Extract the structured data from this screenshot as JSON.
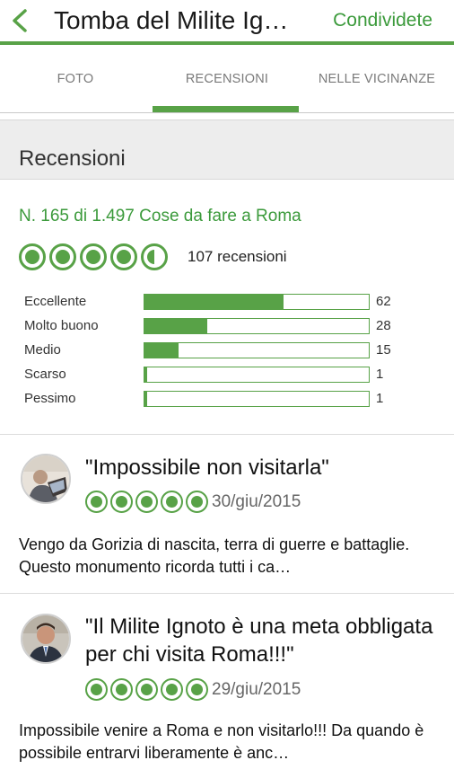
{
  "header": {
    "title": "Tomba del Milite Ig…",
    "share_label": "Condividete",
    "back_icon": "chevron-left-icon",
    "accent_color": "#58a247"
  },
  "tabs": [
    {
      "label": "FOTO",
      "active": false
    },
    {
      "label": "RECENSIONI",
      "active": true
    },
    {
      "label": "NELLE VICINANZE",
      "active": false
    }
  ],
  "section": {
    "title": "Recensioni"
  },
  "summary": {
    "rank": "N. 165 di 1.497 Cose da fare a Roma",
    "rating": 4.5,
    "reviews_count": "107 recensioni"
  },
  "distribution": [
    {
      "label": "Eccellente",
      "count": "62",
      "value": 62
    },
    {
      "label": "Molto buono",
      "count": "28",
      "value": 28
    },
    {
      "label": "Medio",
      "count": "15",
      "value": 15
    },
    {
      "label": "Scarso",
      "count": "1",
      "value": 1
    },
    {
      "label": "Pessimo",
      "count": "1",
      "value": 1
    }
  ],
  "reviews": [
    {
      "title": "\"Impossibile non visitarla\"",
      "rating": 5,
      "date": "30/giu/2015",
      "text": "Vengo da Gorizia di nascita, terra di guerre  e battaglie. Questo monumento ricorda tutti i ca…"
    },
    {
      "title": "\"Il Milite Ignoto è una meta obbligata per chi visita Roma!!!\"",
      "rating": 5,
      "date": "29/giu/2015",
      "text": "Impossibile venire a Roma e non visitarlo!!! Da quando è possibile entrarvi liberamente è anc…"
    }
  ]
}
